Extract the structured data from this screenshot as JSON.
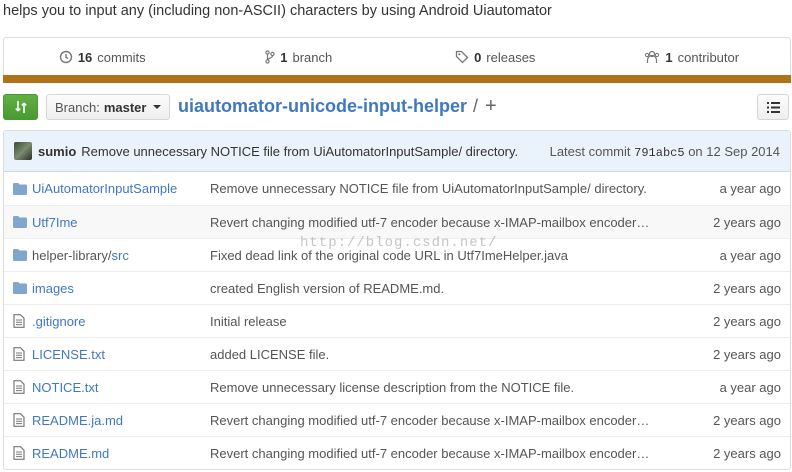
{
  "description": "helps you to input any (including non-ASCII) characters by using Android Uiautomator",
  "summary": {
    "commits_count": "16",
    "commits_label": "commits",
    "branch_count": "1",
    "branch_label": "branch",
    "releases_count": "0",
    "releases_label": "releases",
    "contributor_count": "1",
    "contributor_label": "contributor",
    "language_color": "#b07219"
  },
  "toolbar": {
    "branch_prefix": "Branch:",
    "branch_name": "master",
    "repo_name": "uiautomator-unicode-input-helper",
    "path_sep": "/",
    "path_add": "+"
  },
  "commit": {
    "author": "sumio",
    "message": "Remove unnecessary NOTICE file from UiAutomatorInputSample/ directory.",
    "latest_prefix": "Latest commit",
    "sha": "791abc5",
    "date_text": "on 12 Sep 2014"
  },
  "files": [
    {
      "type": "dir",
      "name": "UiAutomatorInputSample",
      "message": "Remove unnecessary NOTICE file from UiAutomatorInputSample/ directory.",
      "age": "a year ago"
    },
    {
      "type": "dir",
      "name": "Utf7Ime",
      "message": "Revert changing modified utf-7 encoder because x-IMAP-mailbox encoder…",
      "age": "2 years ago"
    },
    {
      "type": "dir",
      "name_prefix": "helper-library/",
      "name": "src",
      "message": "Fixed dead link of the original code URL in Utf7ImeHelper.java",
      "age": "a year ago"
    },
    {
      "type": "dir",
      "name": "images",
      "message": "created English version of README.md.",
      "age": "2 years ago"
    },
    {
      "type": "file",
      "name": ".gitignore",
      "message": "Initial release",
      "age": "2 years ago"
    },
    {
      "type": "file",
      "name": "LICENSE.txt",
      "message": "added LICENSE file.",
      "age": "2 years ago"
    },
    {
      "type": "file",
      "name": "NOTICE.txt",
      "message": "Remove unnecessary license description from the NOTICE file.",
      "age": "a year ago"
    },
    {
      "type": "file",
      "name": "README.ja.md",
      "message": "Revert changing modified utf-7 encoder because x-IMAP-mailbox encoder…",
      "age": "2 years ago"
    },
    {
      "type": "file",
      "name": "README.md",
      "message": "Revert changing modified utf-7 encoder because x-IMAP-mailbox encoder…",
      "age": "2 years ago"
    }
  ],
  "watermark": "http://blog.csdn.net/"
}
